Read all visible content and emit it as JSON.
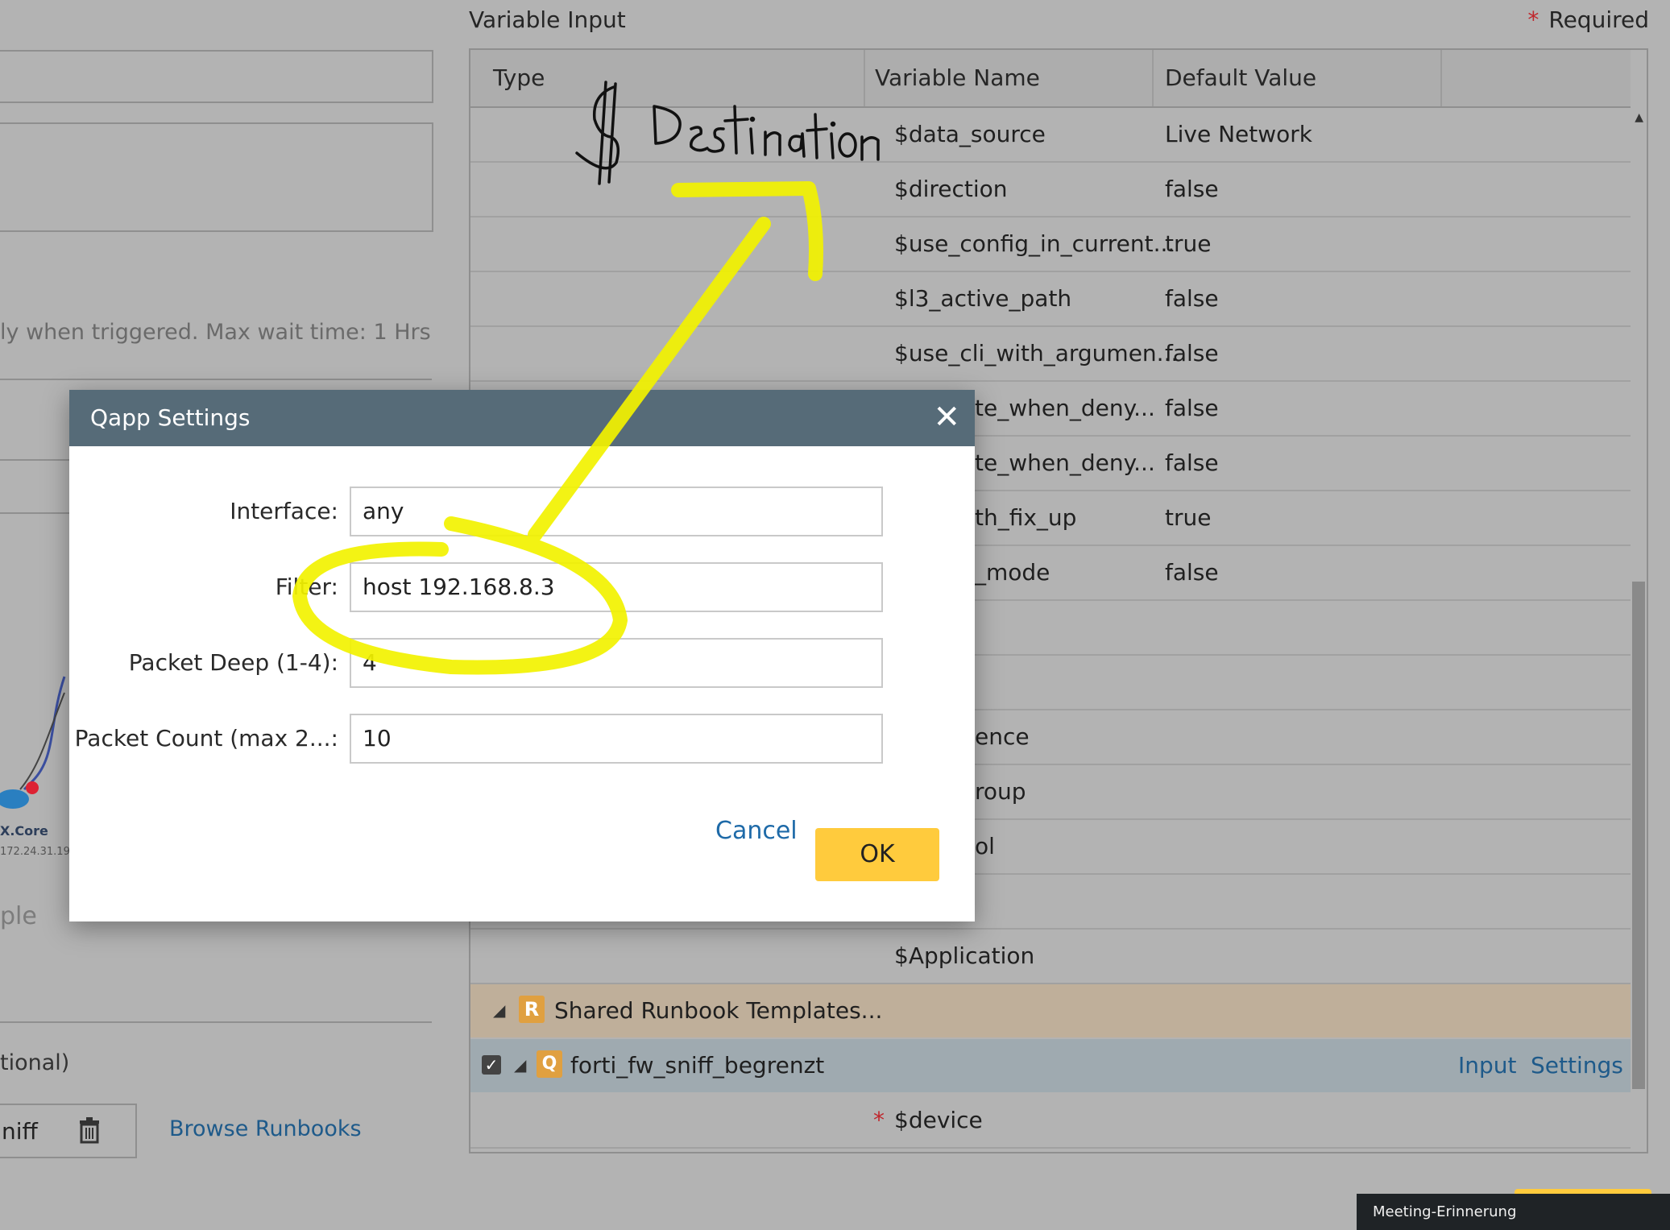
{
  "background": {
    "status_text": "ly when triggered. Max wait time: 1 Hrs",
    "device_name": "X.Core",
    "device_ip": "172.24.31.19",
    "example_text": "ple",
    "optional_text": "tional)",
    "runbook_name_partial": "niff",
    "browse_runbooks": "Browse Runbooks"
  },
  "variable_input": {
    "title": "Variable Input",
    "required_star": "*",
    "required_label": "Required",
    "columns": [
      "Type",
      "Variable Name",
      "Default Value"
    ],
    "rows": [
      {
        "name": "$data_source",
        "value": "Live Network"
      },
      {
        "name": "$direction",
        "value": "false"
      },
      {
        "name": "$use_config_in_current...",
        "value": "true"
      },
      {
        "name": "$l3_active_path",
        "value": "false"
      },
      {
        "name": "$use_cli_with_argumen...",
        "value": "false"
      },
      {
        "name": "te_when_deny...",
        "value": "false"
      },
      {
        "name": "te_when_deny...",
        "value": "false"
      },
      {
        "name": "th_fix_up",
        "value": "true"
      },
      {
        "name": "_mode",
        "value": "false"
      },
      {
        "name": "",
        "value": ""
      },
      {
        "name": "",
        "value": ""
      },
      {
        "name": "ence",
        "value": ""
      },
      {
        "name": "roup",
        "value": ""
      },
      {
        "name": "ol",
        "value": ""
      },
      {
        "name": "",
        "value": ""
      },
      {
        "name": "$Application",
        "value": ""
      }
    ],
    "group_row": {
      "label": "Shared Runbook Templates..."
    },
    "runbook_row": {
      "label": "forti_fw_sniff_begrenzt",
      "input_link": "Input",
      "settings_link": "Settings"
    },
    "device_row": {
      "star": "*",
      "name": "$device"
    }
  },
  "dialog": {
    "title": "Qapp Settings",
    "close": "✕",
    "fields": {
      "interface": {
        "label": "Interface:",
        "value": "any"
      },
      "filter": {
        "label": "Filter:",
        "value": "host 192.168.8.3"
      },
      "packet_deep": {
        "label": "Packet Deep (1-4):",
        "value": "4"
      },
      "packet_count": {
        "label": "Packet Count (max 2...:",
        "value": "10"
      }
    },
    "cancel_label": "Cancel",
    "ok_label": "OK"
  },
  "annotation": {
    "handwritten_text": "$ Destination",
    "color": "#f2f200"
  },
  "toast": {
    "label": "Meeting-Erinnerung"
  },
  "colors": {
    "dialog_header": "#566b78",
    "ok_button": "#ffcb3d",
    "link": "#1e6aa8"
  }
}
